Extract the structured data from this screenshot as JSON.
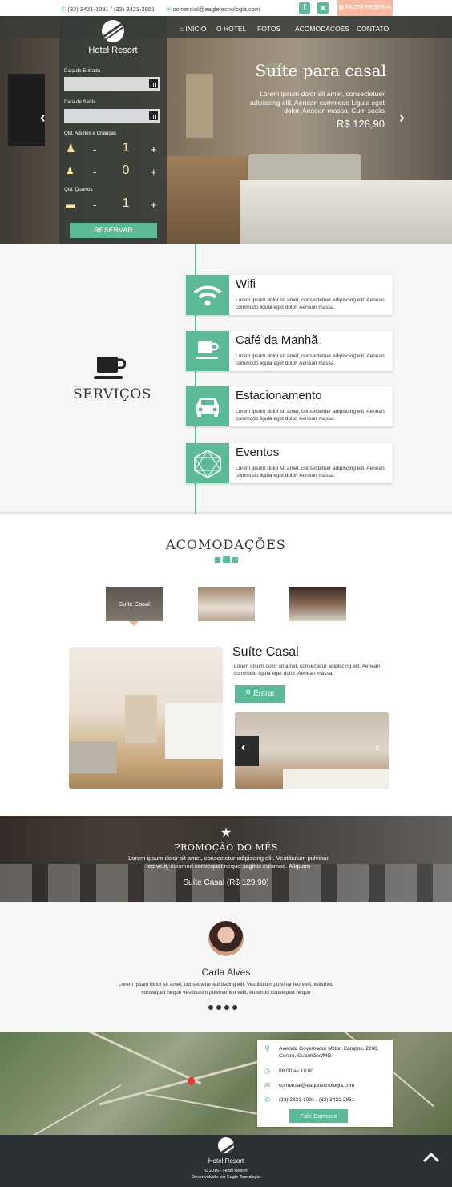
{
  "colors": {
    "accent": "#5cba96",
    "reserve": "#f8b9a0",
    "dark": "#2a3033"
  },
  "topbar": {
    "phone_icon": "phone-icon",
    "phones": "(33) 3421-1091 / (33) 3421-2851",
    "email_icon": "mail-icon",
    "email": "comercial@eagletecnologia.com",
    "reserve_label": "FAZER RESERVA"
  },
  "nav": {
    "items": [
      {
        "label": "INÍCIO"
      },
      {
        "label": "O HOTEL"
      },
      {
        "label": "FOTOS"
      },
      {
        "label": "ACOMODACOES"
      },
      {
        "label": "CONTATO"
      }
    ]
  },
  "brand": {
    "name": "Hotel Resort"
  },
  "booking": {
    "checkin_label": "Data de Entrada",
    "checkout_label": "Data de Saída",
    "guests_label": "Qtd. Adultos e Crianças",
    "adults": "1",
    "children": "0",
    "rooms_label": "Qtd. Quartos",
    "rooms": "1",
    "minus": "-",
    "plus": "+",
    "submit": "RESERVAR"
  },
  "hero": {
    "title": "Suíte para casal",
    "desc": "Lorem ipsum dolor sit amet, consectetuer adipiscing elit. Aenean commodo Ligula eget dolor. Aenean massa. Cum sociis",
    "price": "R$ 128,90",
    "prev": "‹",
    "next": "›"
  },
  "services": {
    "title": "SERVIÇOS",
    "items": [
      {
        "title": "Wifi",
        "desc": "Lorem ipsum dolor sit amet, consectetuer adipiscing elit. Aenean commodo ligula eget dolor. Aenean massa."
      },
      {
        "title": "Café da Manhã",
        "desc": "Lorem ipsum dolor sit amet, consectetuer adipiscing elit. Aenean commodo ligula eget dolor. Aenean massa."
      },
      {
        "title": "Estacionamento",
        "desc": "Lorem ipsum dolor sit amet, consectetuer adipiscing elit. Aenean commodo ligula eget dolor. Aenean massa."
      },
      {
        "title": "Eventos",
        "desc": "Lorem ipsum dolor sit amet, consectetuer adipiscing elit. Aenean commodo ligula eget dolor. Aenean massa."
      }
    ]
  },
  "acomodacoes": {
    "title": "ACOMODAÇÕES",
    "thumb1_label": "Suíte Casal",
    "room_title": "Suíte Casal",
    "room_desc": "Lorem ipsum dolor sit amet, consectetur adipiscing elit. Aenean commodo ligula eget dolor. Aenean massa.",
    "enter_label": "Entrar",
    "prev": "‹",
    "next": "›"
  },
  "promo": {
    "star": "★",
    "title": "PROMOÇÃO DO MÊS",
    "desc": "Lorem ipsum dolor sit amet, consectetur adipiscing elit. Vestibulum pulvinar leo velit, euismod consequat neque sagittis euismod. Aliquam",
    "price": "Suíte Casal (R$ 129,90)"
  },
  "testimonial": {
    "name": "Carla Alves",
    "text": "Lorem ipsum dolor sit amet, consectetur adipiscing elit. Vestibulum pulvinar leo velit, euismod consequat neque vestibulum pulvinar leo velit, euismod consequat neque"
  },
  "contact": {
    "address": "Avenida Governador Milton Campos, 2296, Centro, Guanhães/MG",
    "hours": "08:00 as 18:00",
    "email": "comercial@eagletecnologia.com",
    "phones": "(33) 3421-1091 / (33) 3421-2851",
    "button": "Fale Conosco"
  },
  "footer": {
    "name": "Hotel Resort",
    "copy": "© 2016 - Hotel Resort",
    "dev": "Desenvolvido por Eagle Tecnologia"
  }
}
